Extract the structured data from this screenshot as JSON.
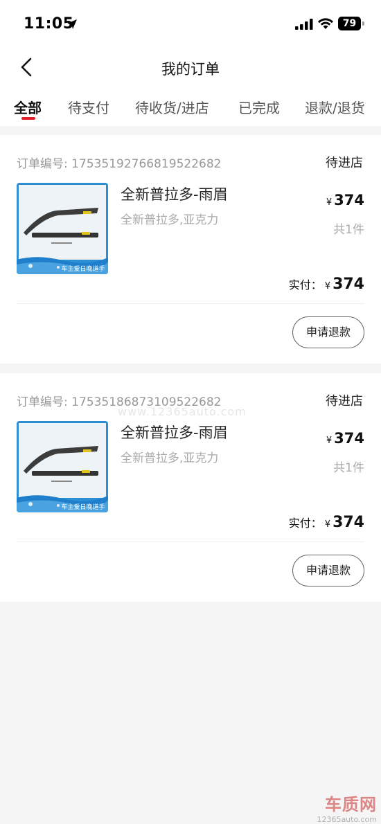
{
  "status_bar": {
    "time": "11:05",
    "battery": "79"
  },
  "nav": {
    "title": "我的订单"
  },
  "tabs": [
    {
      "label": "全部",
      "active": true
    },
    {
      "label": "待支付",
      "active": false
    },
    {
      "label": "待收货/进店",
      "active": false
    },
    {
      "label": "已完成",
      "active": false
    },
    {
      "label": "退款/退货",
      "active": false
    }
  ],
  "orders": [
    {
      "order_no_label": "订单编号:",
      "order_no": "17535192766819522682",
      "status": "待进店",
      "product_name": "全新普拉多-雨眉",
      "spec": "全新普拉多,亚克力",
      "currency": "¥",
      "unit_price": "374",
      "quantity": "共1件",
      "total_label": "实付：",
      "total": "374",
      "refund_button": "申请退款",
      "thumb_caption": "车主爱日晚道手"
    },
    {
      "order_no_label": "订单编号:",
      "order_no": "17535186873109522682",
      "status": "待进店",
      "product_name": "全新普拉多-雨眉",
      "spec": "全新普拉多,亚克力",
      "currency": "¥",
      "unit_price": "374",
      "quantity": "共1件",
      "total_label": "实付：",
      "total": "374",
      "refund_button": "申请退款",
      "thumb_caption": "车主爱日晚道手"
    }
  ],
  "watermark": {
    "brand": "车质网",
    "url": "12365auto.com",
    "center": "www.12365auto.com"
  },
  "colors": {
    "accent": "#e61e2a",
    "background": "#f5f5f5"
  }
}
